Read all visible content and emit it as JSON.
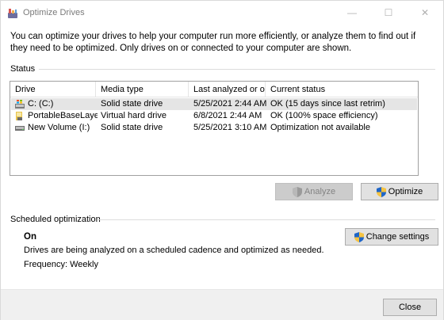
{
  "window": {
    "title": "Optimize Drives",
    "icon": "optimize-drives-icon",
    "controls": {
      "minimize": "—",
      "maximize": "☐",
      "close": "✕"
    }
  },
  "intro_text": "You can optimize your drives to help your computer run more efficiently, or analyze them to find out if they need to be optimized. Only drives on or connected to your computer are shown.",
  "status": {
    "label": "Status",
    "columns": [
      "Drive",
      "Media type",
      "Last analyzed or o...",
      "Current status"
    ],
    "rows": [
      {
        "drive": "C: (C:)",
        "icon": "system-drive-icon",
        "media": "Solid state drive",
        "last": "5/25/2021 2:44 AM",
        "status": "OK (15 days since last retrim)",
        "selected": true
      },
      {
        "drive": "PortableBaseLayer ...",
        "icon": "virtual-drive-icon",
        "media": "Virtual hard drive",
        "last": "6/8/2021 2:44 AM",
        "status": "OK (100% space efficiency)",
        "selected": false
      },
      {
        "drive": "New Volume (I:)",
        "icon": "drive-icon",
        "media": "Solid state drive",
        "last": "5/25/2021 3:10 AM",
        "status": "Optimization not available",
        "selected": false
      }
    ]
  },
  "buttons": {
    "analyze": "Analyze",
    "optimize": "Optimize",
    "change_settings": "Change settings",
    "close": "Close"
  },
  "scheduled": {
    "label": "Scheduled optimization",
    "state": "On",
    "description": "Drives are being analyzed on a scheduled cadence and optimized as needed.",
    "frequency": "Frequency: Weekly"
  },
  "colors": {
    "selection": "#e5e5e5",
    "button_face": "#e1e1e1",
    "footer": "#f0f0f0",
    "disabled_text": "#838383"
  }
}
